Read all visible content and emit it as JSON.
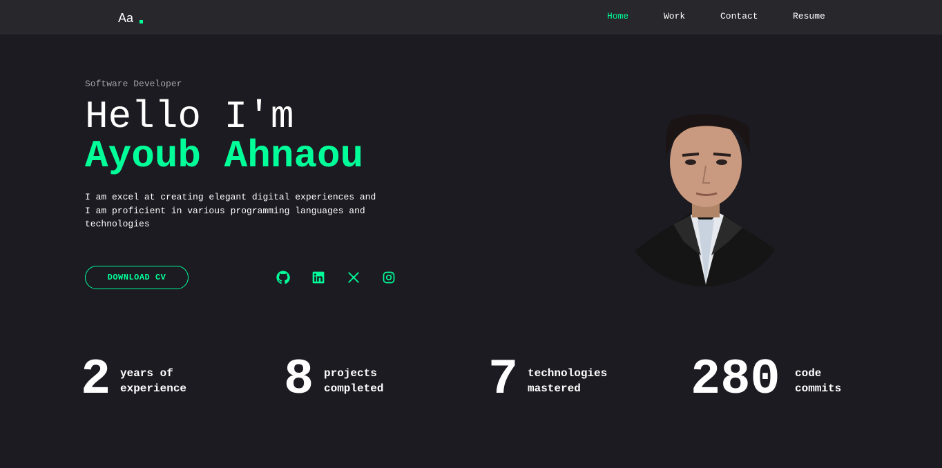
{
  "nav": {
    "logo": "Aa",
    "links": [
      {
        "label": "Home",
        "active": true
      },
      {
        "label": "Work",
        "active": false
      },
      {
        "label": "Contact",
        "active": false
      },
      {
        "label": "Resume",
        "active": false
      }
    ]
  },
  "hero": {
    "subtitle": "Software Developer",
    "greeting": "Hello I'm",
    "name": "Ayoub Ahnaou",
    "description": "I am excel at creating elegant digital experiences and I am proficient in various programming languages and technologies",
    "cv_button": "DOWNLOAD CV"
  },
  "social": [
    "github-icon",
    "linkedin-icon",
    "x-icon",
    "instagram-icon"
  ],
  "stats": [
    {
      "number": "2",
      "label_line1": "years of",
      "label_line2": "experience"
    },
    {
      "number": "8",
      "label_line1": "projects",
      "label_line2": "completed"
    },
    {
      "number": "7",
      "label_line1": "technologies",
      "label_line2": "mastered"
    },
    {
      "number": "280",
      "label_line1": "code",
      "label_line2": "commits"
    }
  ],
  "colors": {
    "accent": "#00ff99",
    "background": "#1c1b22",
    "navbar": "#27272c",
    "text": "#ffffff",
    "muted": "#a3a3aa"
  }
}
